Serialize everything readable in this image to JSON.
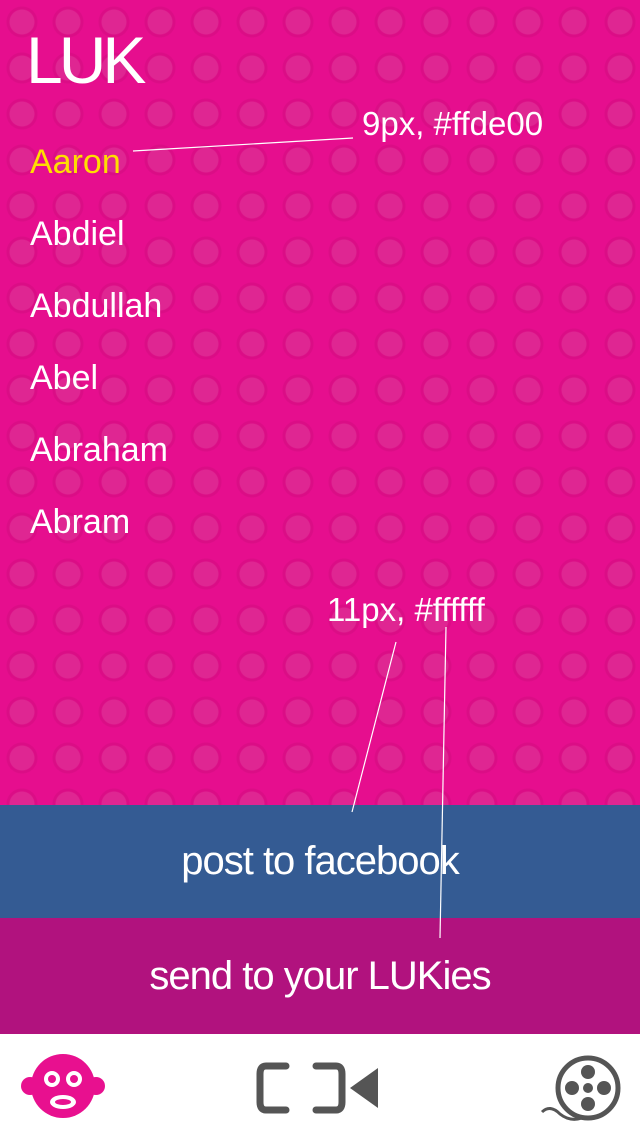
{
  "app": {
    "title": "LUK"
  },
  "names": [
    {
      "label": "Aaron",
      "selected": true
    },
    {
      "label": "Abdiel",
      "selected": false
    },
    {
      "label": "Abdullah",
      "selected": false
    },
    {
      "label": "Abel",
      "selected": false
    },
    {
      "label": "Abraham",
      "selected": false
    },
    {
      "label": "Abram",
      "selected": false
    }
  ],
  "annotations": {
    "selected_name": "9px, #ffde00",
    "button_text": "11px, #ffffff"
  },
  "actions": {
    "facebook_label": "post to facebook",
    "lukies_label": "send to your LUKies"
  },
  "tabbar": {
    "items": [
      {
        "icon": "monkey-icon",
        "active": true
      },
      {
        "icon": "video-camera-icon",
        "active": false
      },
      {
        "icon": "film-reel-icon",
        "active": false
      }
    ]
  },
  "colors": {
    "background": "#e60e8e",
    "selected_text": "#ffde00",
    "facebook": "#345b93",
    "lukies": "#b1127e",
    "tab_active": "#e8108f",
    "tab_inactive": "#555555"
  }
}
